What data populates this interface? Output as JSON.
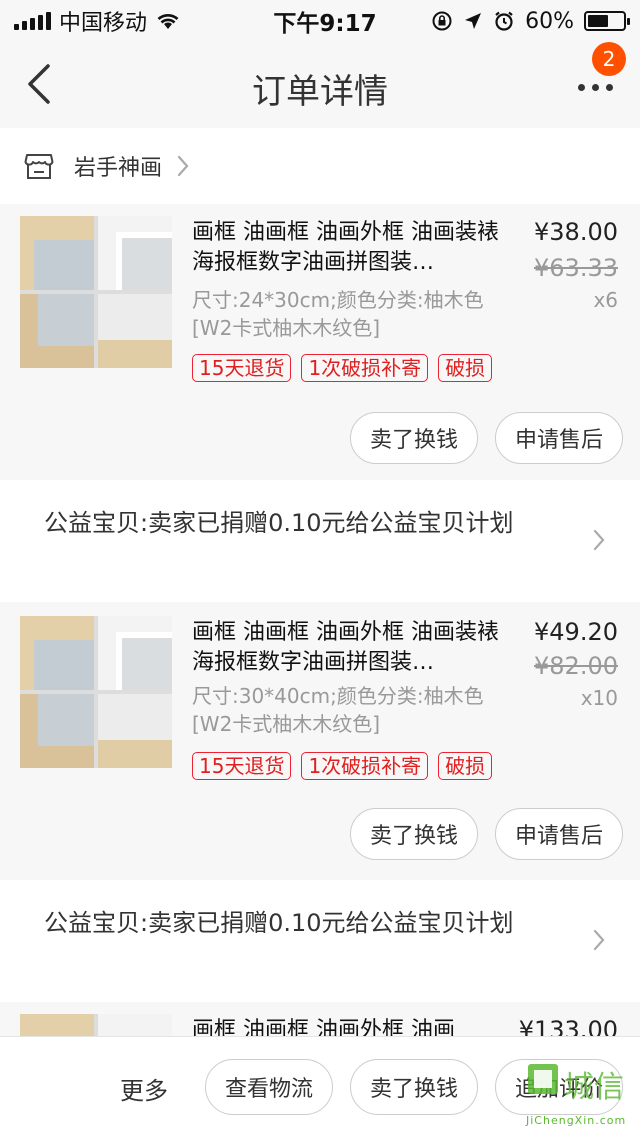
{
  "status_bar": {
    "carrier": "中国移动",
    "time": "下午9:17",
    "battery": "60%",
    "battery_level": 0.6
  },
  "nav": {
    "title": "订单详情",
    "badge_count": "2"
  },
  "shop": {
    "name": "岩手神画"
  },
  "items": [
    {
      "title": "画框 油画框 油画外框 油画装裱 海报框数字油画拼图装…",
      "spec": "尺寸:24*30cm;颜色分类:柚木色[W2卡式柚木木纹色]",
      "price": "¥38.00",
      "original_price": "¥63.33",
      "quantity": "x6",
      "tags": [
        "15天退货",
        "1次破损补寄",
        "破损"
      ],
      "buttons": {
        "sell": "卖了换钱",
        "after_sale": "申请售后"
      }
    },
    {
      "title": "画框 油画框 油画外框 油画装裱 海报框数字油画拼图装…",
      "spec": "尺寸:30*40cm;颜色分类:柚木色[W2卡式柚木木纹色]",
      "price": "¥49.20",
      "original_price": "¥82.00",
      "quantity": "x10",
      "tags": [
        "15天退货",
        "1次破损补寄",
        "破损"
      ],
      "buttons": {
        "sell": "卖了换钱",
        "after_sale": "申请售后"
      }
    },
    {
      "title": "画框 油画框 油画外框 油画",
      "price": "¥133.00"
    }
  ],
  "charity": [
    {
      "text": "公益宝贝:卖家已捐赠0.10元给公益宝贝计划"
    },
    {
      "text": "公益宝贝:卖家已捐赠0.10元给公益宝贝计划"
    }
  ],
  "bottom_bar": {
    "more": "更多",
    "logistics": "查看物流",
    "sell": "卖了换钱",
    "review": "追加评价"
  },
  "watermark": {
    "text": "城信",
    "sub": "JiChengXin.com"
  },
  "colors": {
    "accent": "#ff5000",
    "tag_red": "#e02020",
    "text_gray": "#999999"
  }
}
